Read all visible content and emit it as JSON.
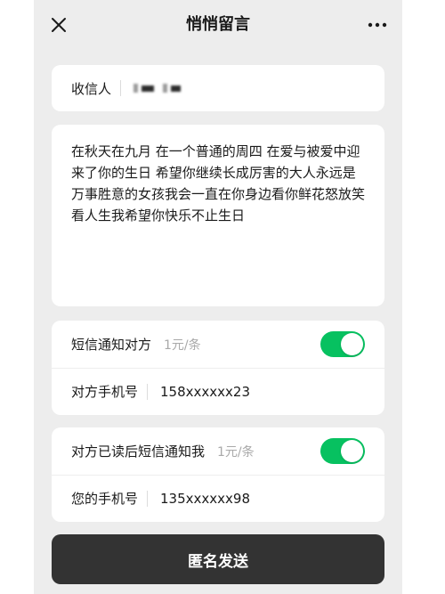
{
  "header": {
    "title": "悄悄留言",
    "close_icon": "close-icon",
    "more_icon": "more-icon"
  },
  "recipient": {
    "label": "收信人",
    "value_redacted": true
  },
  "message": {
    "text": "在秋天在九月 在一个普通的周四 在爱与被爱中迎来了你的生日 希望你继续长成厉害的大人永远是万事胜意的女孩我会一直在你身边看你鲜花怒放笑看人生我希望你快乐不止生日"
  },
  "sms_notify_recipient": {
    "label": "短信通知对方",
    "price": "1元/条",
    "enabled": true,
    "phone_label": "对方手机号",
    "phone_value": "158xxxxxx23"
  },
  "sms_notify_me": {
    "label": "对方已读后短信通知我",
    "price": "1元/条",
    "enabled": true,
    "phone_label": "您的手机号",
    "phone_value": "135xxxxxx98"
  },
  "submit": {
    "label": "匿名发送"
  },
  "colors": {
    "accent_green": "#07c160",
    "button_dark": "#333333",
    "background": "#ededed"
  }
}
